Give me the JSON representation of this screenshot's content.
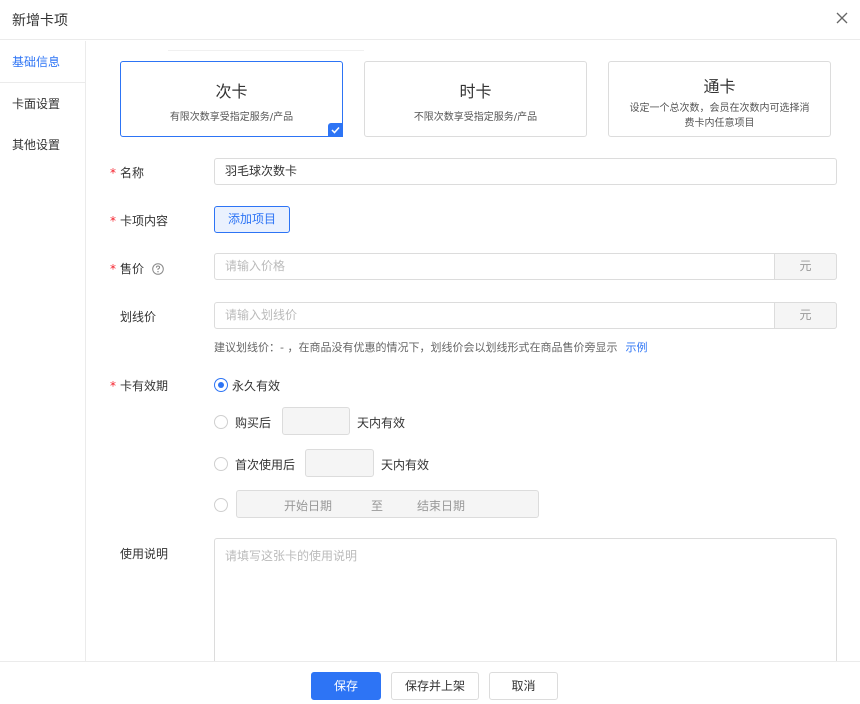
{
  "header": {
    "title": "新增卡项"
  },
  "sidebar": {
    "items": [
      {
        "label": "基础信息"
      },
      {
        "label": "卡面设置"
      },
      {
        "label": "其他设置"
      }
    ]
  },
  "card_types": [
    {
      "title": "次卡",
      "desc": "有限次数享受指定服务/产品",
      "selected": true
    },
    {
      "title": "时卡",
      "desc": "不限次数享受指定服务/产品",
      "selected": false
    },
    {
      "title": "通卡",
      "desc": "设定一个总次数，会员在次数内可选择消费卡内任意项目",
      "selected": false
    }
  ],
  "form": {
    "required_mark": "*",
    "name": {
      "label": "名称",
      "value": "羽毛球次数卡"
    },
    "content": {
      "label": "卡项内容",
      "button": "添加项目"
    },
    "price": {
      "label": "售价",
      "placeholder": "请输入价格",
      "unit": "元"
    },
    "strike_price": {
      "label": "划线价",
      "placeholder": "请输入划线价",
      "unit": "元",
      "hint": "建议划线价：- ，在商品没有优惠的情况下，划线价会以划线形式在商品售价旁显示",
      "hint_link": "示例"
    },
    "validity": {
      "label": "卡有效期",
      "options": {
        "forever": {
          "label": "永久有效",
          "checked": true
        },
        "after_purchase": {
          "prefix": "购买后",
          "suffix": "天内有效"
        },
        "after_first_use": {
          "prefix": "首次使用后",
          "suffix": "天内有效"
        },
        "date_range": {
          "start": "开始日期",
          "separator": "至",
          "end": "结束日期"
        }
      }
    },
    "usage": {
      "label": "使用说明",
      "placeholder": "请填写这张卡的使用说明"
    }
  },
  "footer": {
    "save": "保存",
    "save_publish": "保存并上架",
    "cancel": "取消"
  },
  "colors": {
    "accent": "#2d74f5",
    "required": "#f5222d"
  }
}
